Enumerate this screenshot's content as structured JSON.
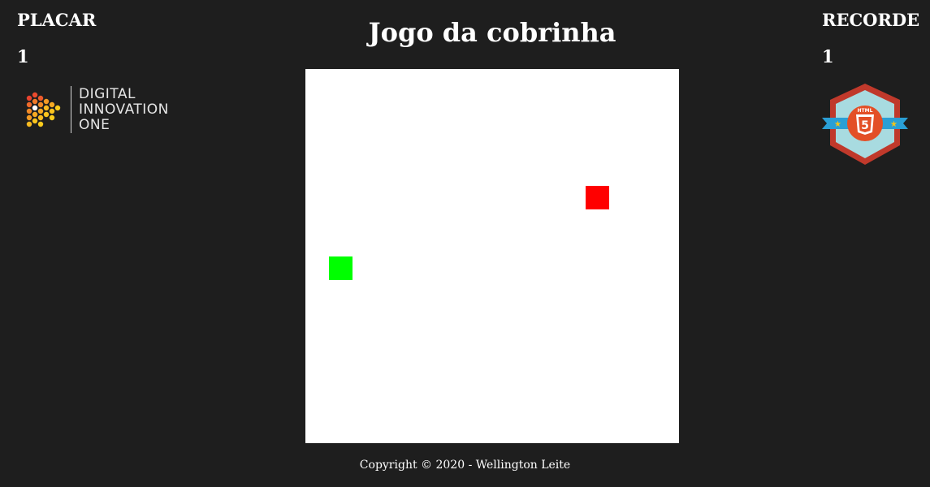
{
  "header": {
    "title": "Jogo da cobrinha"
  },
  "score": {
    "label": "PLACAR",
    "value": "1"
  },
  "record": {
    "label": "RECORDE",
    "value": "1"
  },
  "sponsor_logo": {
    "lines": [
      "DIGITAL",
      "INNOVATION",
      "ONE"
    ],
    "icon": "dio-logo-icon"
  },
  "badge": {
    "icon": "html5-badge-icon",
    "text": "HTML"
  },
  "game": {
    "board_color": "#ffffff",
    "snake_color": "#00ff00",
    "food_color": "#ff0000",
    "snake_cells": [
      {
        "col": 1,
        "row": 8
      }
    ],
    "food_cell": {
      "col": 12,
      "row": 5
    }
  },
  "footer": {
    "copyright": "Copyright © 2020 - Wellington Leite"
  }
}
